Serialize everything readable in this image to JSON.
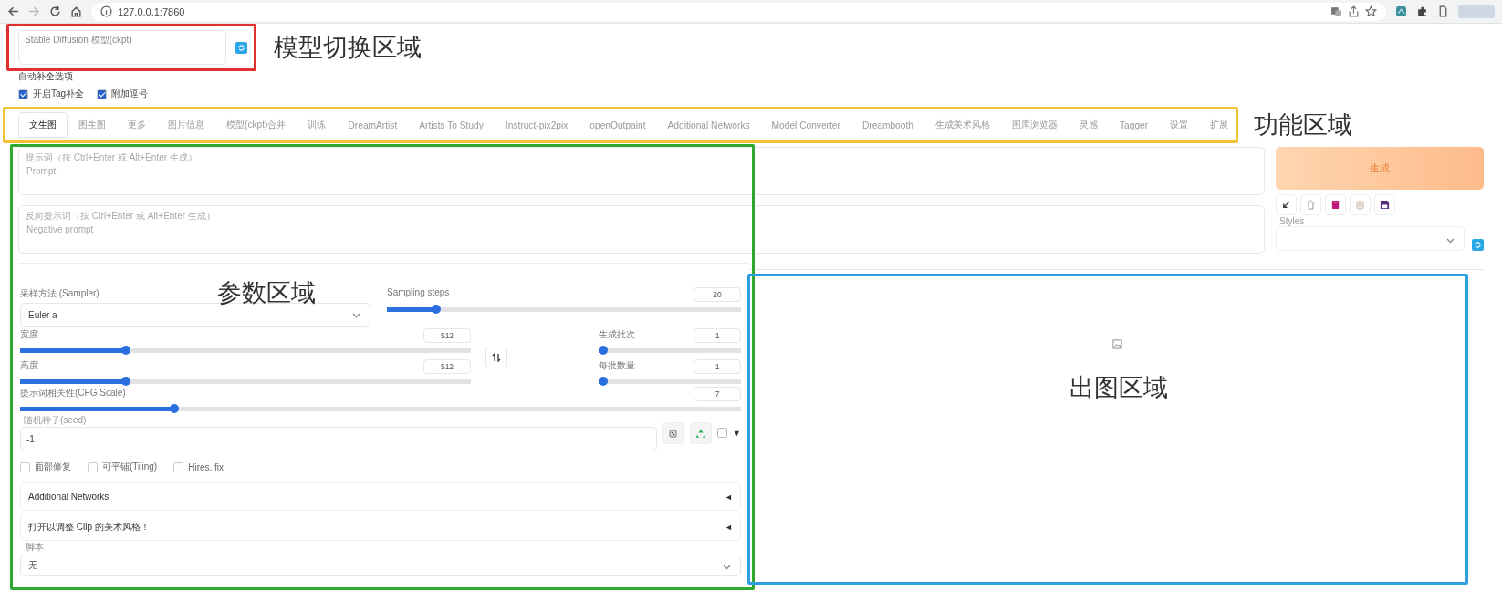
{
  "browser": {
    "url": "127.0.0.1:7860"
  },
  "model_selector": {
    "label": "Stable Diffusion 模型(ckpt)"
  },
  "autocomplete": {
    "title": "自动补全选项",
    "options": [
      {
        "label": "开启Tag补全",
        "checked": true
      },
      {
        "label": "附加逗号",
        "checked": true
      }
    ]
  },
  "tabs": [
    {
      "label": "文生图",
      "selected": true
    },
    {
      "label": "图生图",
      "selected": false
    },
    {
      "label": "更多",
      "selected": false
    },
    {
      "label": "图片信息",
      "selected": false
    },
    {
      "label": "模型(ckpt)合并",
      "selected": false
    },
    {
      "label": "训练",
      "selected": false
    },
    {
      "label": "DreamArtist",
      "selected": false
    },
    {
      "label": "Artists To Study",
      "selected": false
    },
    {
      "label": "Instruct-pix2pix",
      "selected": false
    },
    {
      "label": "openOutpaint",
      "selected": false
    },
    {
      "label": "Additional Networks",
      "selected": false
    },
    {
      "label": "Model Converter",
      "selected": false
    },
    {
      "label": "Dreambooth",
      "selected": false
    },
    {
      "label": "生成美术风格",
      "selected": false
    },
    {
      "label": "图库浏览器",
      "selected": false
    },
    {
      "label": "灵感",
      "selected": false
    },
    {
      "label": "Tagger",
      "selected": false
    },
    {
      "label": "设置",
      "selected": false
    },
    {
      "label": "扩展",
      "selected": false
    }
  ],
  "prompt": {
    "label": "提示词（按 Ctrl+Enter 或 Alt+Enter 生成）",
    "placeholder": "Prompt"
  },
  "negative_prompt": {
    "label": "反向提示词（按 Ctrl+Enter 或 Alt+Enter 生成）",
    "placeholder": "Negative prompt"
  },
  "actions": {
    "generate": "生成",
    "styles_label": "Styles"
  },
  "sampler": {
    "label": "采样方法 (Sampler)",
    "value": "Euler a"
  },
  "sampling_steps": {
    "label": "Sampling steps",
    "value": "20",
    "level": 0.13
  },
  "width": {
    "label": "宽度",
    "value": "512",
    "level": 0.23
  },
  "height": {
    "label": "高度",
    "value": "512",
    "level": 0.23
  },
  "batch_count": {
    "label": "生成批次",
    "value": "1",
    "level": 0
  },
  "batch_size": {
    "label": "每批数量",
    "value": "1",
    "level": 0
  },
  "cfg_scale": {
    "label": "提示词相关性(CFG Scale)",
    "value": "7",
    "level": 0.21
  },
  "seed": {
    "label": "随机种子(seed)",
    "value": "-1",
    "extra_checked": false,
    "extra_toggle": "▼"
  },
  "options": [
    {
      "label": "面部修复",
      "checked": false
    },
    {
      "label": "可平铺(Tiling)",
      "checked": false
    },
    {
      "label": "Hires. fix",
      "checked": false
    }
  ],
  "accordions": [
    {
      "title": "Additional Networks",
      "toggle": "◄"
    },
    {
      "title": "打开以调整 Clip 的美术风格！",
      "toggle": "◄"
    }
  ],
  "script": {
    "label": "脚本",
    "value": "无"
  },
  "annotations": [
    {
      "label": "模型切换区域",
      "color": "#e03030"
    },
    {
      "label": "功能区域",
      "color": "#f2c232"
    },
    {
      "label": "参数区域",
      "color": "#2fa830"
    },
    {
      "label": "出图区域",
      "color": "#2f9ee0"
    }
  ]
}
